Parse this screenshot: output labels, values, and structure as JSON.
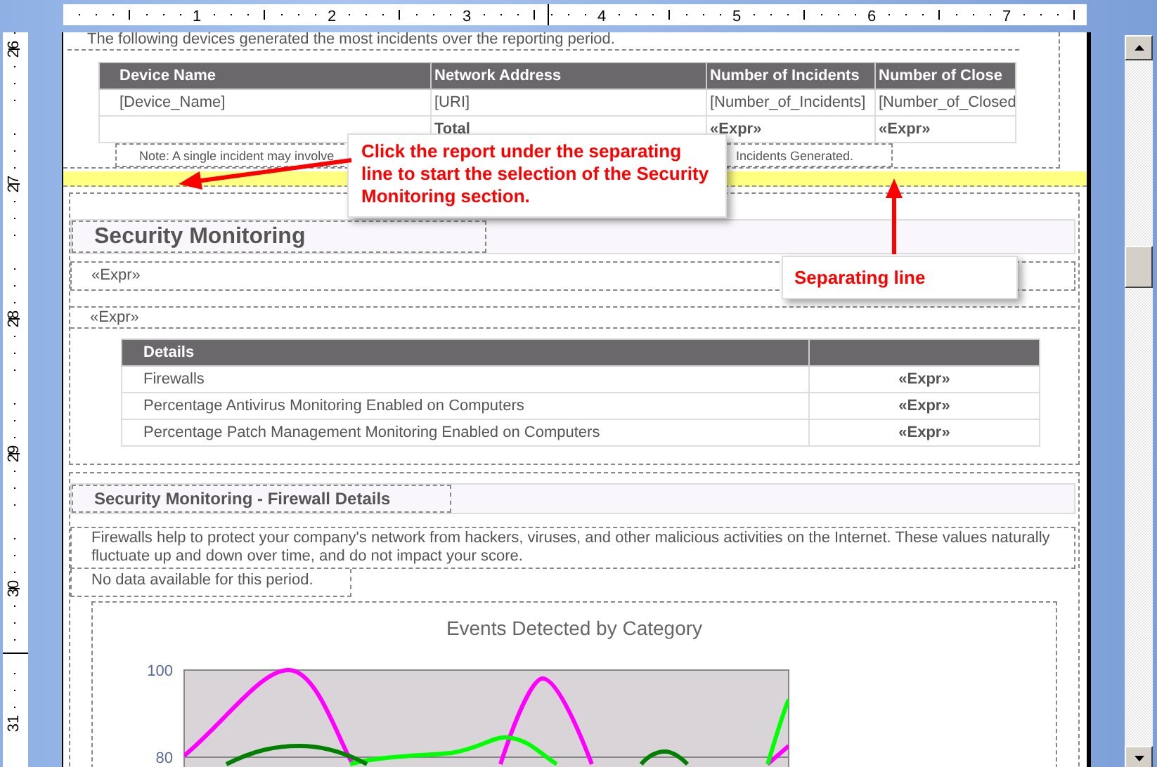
{
  "ruler": {
    "labels": [
      "1",
      "2",
      "3",
      "4",
      "5",
      "6",
      "7"
    ]
  },
  "side_ruler": {
    "labels": [
      "26",
      "27",
      "28",
      "29",
      "30",
      "31"
    ]
  },
  "incidents_section": {
    "intro": "The following devices generated the most incidents over the reporting period.",
    "table": {
      "columns": [
        "Device Name",
        "Network Address",
        "Number of Incidents",
        "Number of Close"
      ],
      "rows": [
        {
          "kind": "detail",
          "device_name": "[Device_Name]",
          "network_address": "[URI]",
          "incidents": "[Number_of_Incidents]",
          "closed": "[Number_of_Closed"
        },
        {
          "kind": "total",
          "network_address": "Total",
          "incidents": "«Expr»",
          "closed": "«Expr»"
        }
      ]
    },
    "note": [
      "Note: A single incident may involve",
      "Incidents Generated."
    ]
  },
  "security_section": {
    "title": "Security Monitoring",
    "expressions": [
      "«Expr»",
      "«Expr»"
    ],
    "details_table": {
      "columns": [
        "Details"
      ],
      "rows": [
        {
          "label": "Firewalls",
          "value": "«Expr»"
        },
        {
          "label": "Percentage Antivirus Monitoring Enabled on Computers",
          "value": "«Expr»"
        },
        {
          "label": "Percentage Patch Management Monitoring Enabled on Computers",
          "value": "«Expr»"
        }
      ]
    }
  },
  "firewall_section": {
    "title": "Security Monitoring - Firewall Details",
    "description": "Firewalls help to protect your company's network from hackers, viruses, and other malicious activities on the Internet.  These values naturally fluctuate up and down over time, and do not impact your score.",
    "no_data": "No data available for this period.",
    "chart": {
      "title": "Events Detected by Category",
      "y_labels": [
        "100",
        "80"
      ]
    }
  },
  "callouts": [
    {
      "text": "Click the report under the separating line to start the selection of the Security Monitoring section."
    },
    {
      "text": "Separating line"
    }
  ]
}
